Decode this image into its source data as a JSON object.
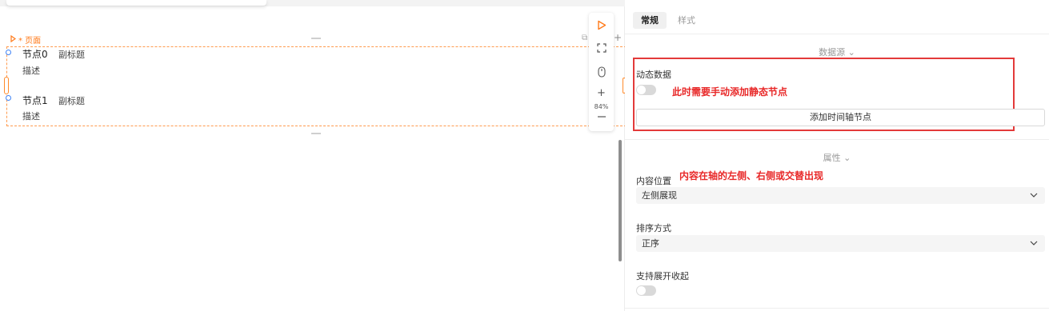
{
  "canvas": {
    "page_tag": "* 页面",
    "nodes": [
      {
        "title": "节点0",
        "subtitle": "副标题",
        "description": "描述"
      },
      {
        "title": "节点1",
        "subtitle": "副标题",
        "description": "描述"
      }
    ],
    "zoom_level": "84%",
    "icons": [
      "play-icon",
      "fullscreen-icon",
      "mouse-icon",
      "zoom-in-icon",
      "zoom-out-icon"
    ]
  },
  "panel": {
    "tabs": [
      {
        "label": "常规",
        "active": true
      },
      {
        "label": "样式",
        "active": false
      }
    ],
    "datasource": {
      "header": "数据源 ⌄",
      "dynamic_label": "动态数据",
      "dynamic_on": false,
      "annotation": "此时需要手动添加静态节点",
      "add_button": "添加时间轴节点"
    },
    "properties": {
      "header": "属性 ⌄",
      "content_position_label": "内容位置",
      "content_position_annotation": "内容在轴的左侧、右侧或交替出现",
      "content_position_value": "左侧展现",
      "sort_label": "排序方式",
      "sort_value": "正序",
      "collapse_label": "支持展开收起",
      "collapse_on": false
    }
  },
  "colors": {
    "accent": "#ff7a1a",
    "annotation_red": "#e82828",
    "node_dot": "#3d82f6"
  }
}
